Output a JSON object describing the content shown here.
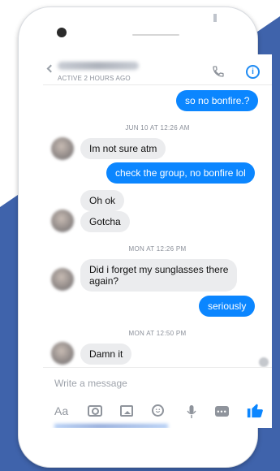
{
  "header": {
    "status": "ACTIVE 2 HOURS AGO"
  },
  "messages": [
    {
      "text": "so no bonfire.?",
      "from": "me"
    },
    {
      "text": "Im not sure atm",
      "from": "them"
    },
    {
      "text": "check the group, no bonfire lol",
      "from": "me"
    },
    {
      "text": "Oh ok",
      "from": "them"
    },
    {
      "text": "Gotcha",
      "from": "them"
    },
    {
      "text": "Did i forget my sunglasses there",
      "text2": "again?",
      "from": "them"
    },
    {
      "text": "seriously",
      "from": "me"
    },
    {
      "text": "Damn it",
      "from": "them"
    }
  ],
  "timestamps": [
    "JUN 10 AT 12:26 AM",
    "MON AT 12:26 PM",
    "MON AT 12:50 PM"
  ],
  "composer": {
    "placeholder": "Write a message",
    "aa_label": "Aa",
    "tools": [
      "text-format-icon",
      "camera-icon",
      "gallery-icon",
      "emoji-icon",
      "microphone-icon",
      "more-icon",
      "like-icon"
    ]
  },
  "colors": {
    "accent": "#0b86ff",
    "received_bubble": "#ebecee",
    "background_blue": "#3f63ab"
  }
}
